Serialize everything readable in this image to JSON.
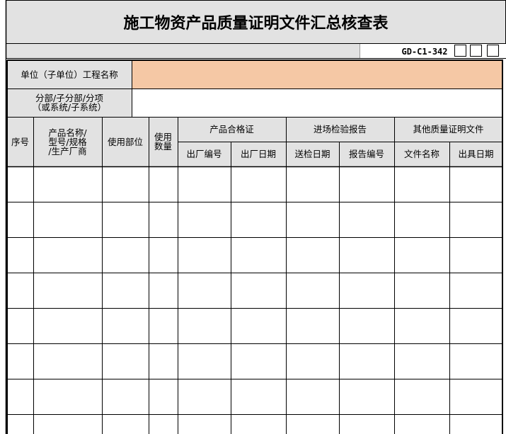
{
  "form": {
    "title": "施工物资产品质量证明文件汇总核查表",
    "code": "GD-C1-342",
    "check_boxes": 3
  },
  "info_rows": [
    {
      "label": "单位（子单位）工程名称",
      "value": "",
      "value_color": "#f5c8a5"
    },
    {
      "label_line1": "分部/子分部/分项",
      "label_line2": "（或系统/子系统）",
      "value": ""
    }
  ],
  "table": {
    "headers": {
      "seq": "序号",
      "product_line1": "产品名称/",
      "product_line2": "型号/规格",
      "product_line3": "/生产厂商",
      "location": "使用部位",
      "qty_line1": "使用",
      "qty_line2": "数量",
      "cert_group": "产品合格证",
      "cert_no": "出厂编号",
      "cert_date": "出厂日期",
      "inspect_group": "进场检验报告",
      "inspect_date": "送检日期",
      "inspect_no": "报告编号",
      "other_group": "其他质量证明文件",
      "doc_name": "文件名称",
      "doc_date": "出具日期"
    },
    "rows": 8
  }
}
